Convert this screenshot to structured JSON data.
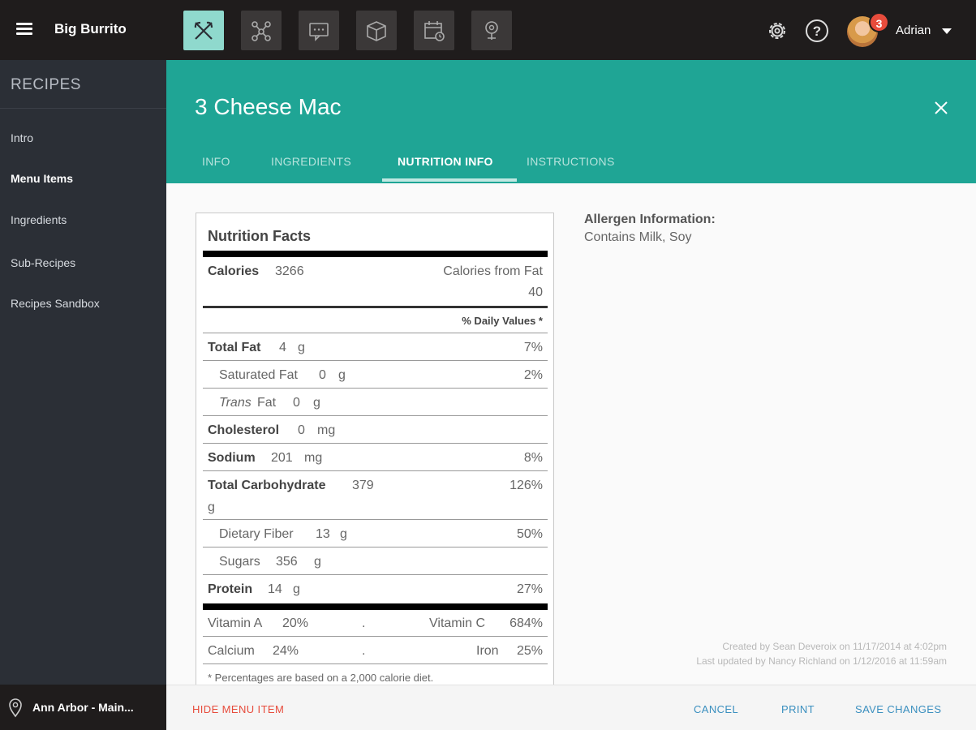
{
  "app": {
    "title": "Big Burrito"
  },
  "user": {
    "name": "Adrian",
    "notifications": "3"
  },
  "sidebar": {
    "heading": "RECIPES",
    "items": [
      {
        "label": "Intro"
      },
      {
        "label": "Menu Items"
      },
      {
        "label": "Ingredients"
      },
      {
        "label": "Sub-Recipes"
      },
      {
        "label": "Recipes Sandbox"
      }
    ],
    "location": "Ann Arbor - Main..."
  },
  "recipe": {
    "title": "3 Cheese Mac",
    "tabs": [
      {
        "label": "INFO"
      },
      {
        "label": "INGREDIENTS"
      },
      {
        "label": "NUTRITION INFO"
      },
      {
        "label": "INSTRUCTIONS"
      }
    ]
  },
  "nutrition": {
    "title": "Nutrition Facts",
    "calories_label": "Calories",
    "calories_value": "3266",
    "calories_fat_label": "Calories from Fat",
    "calories_fat_value": "40",
    "daily_values_label": "% Daily Values *",
    "rows": {
      "total_fat": {
        "label": "Total Fat",
        "amount": "4",
        "unit": "g",
        "dv": "7%"
      },
      "saturated_fat": {
        "label": "Saturated Fat",
        "amount": "0",
        "unit": "g",
        "dv": "2%"
      },
      "trans_fat": {
        "label_italic": "Trans",
        "label_rest": "Fat",
        "amount": "0",
        "unit": "g"
      },
      "cholesterol": {
        "label": "Cholesterol",
        "amount": "0",
        "unit": "mg"
      },
      "sodium": {
        "label": "Sodium",
        "amount": "201",
        "unit": "mg",
        "dv": "8%"
      },
      "total_carbohydrate": {
        "label": "Total Carbohydrate",
        "amount": "379",
        "unit": "g",
        "dv": "126%"
      },
      "dietary_fiber": {
        "label": "Dietary Fiber",
        "amount": "13",
        "unit": "g",
        "dv": "50%"
      },
      "sugars": {
        "label": "Sugars",
        "amount": "356",
        "unit": "g"
      },
      "protein": {
        "label": "Protein",
        "amount": "14",
        "unit": "g",
        "dv": "27%"
      }
    },
    "vitamins": {
      "vitamin_a": {
        "label": "Vitamin A",
        "value": "20%"
      },
      "vitamin_c": {
        "label": "Vitamin C",
        "value": "684%"
      },
      "calcium": {
        "label": "Calcium",
        "value": "24%"
      },
      "iron": {
        "label": "Iron",
        "value": "25%"
      },
      "separator": "."
    },
    "footnote": "* Percentages are based on a 2,000 calorie diet."
  },
  "allergen": {
    "title": "Allergen Information:",
    "text": "Contains Milk, Soy"
  },
  "meta": {
    "created": "Created by Sean Deveroix on 11/17/2014 at 4:02pm",
    "updated": "Last updated by Nancy Richland on 1/12/2016 at 11:59am"
  },
  "footer": {
    "hide": "HIDE MENU ITEM",
    "cancel": "CANCEL",
    "print": "PRINT",
    "save": "SAVE CHANGES"
  },
  "icons": [
    "menu-icon",
    "utensils-icon",
    "network-icon",
    "chat-icon",
    "box-icon",
    "calendar-icon",
    "location-icon",
    "gear-icon",
    "help-icon",
    "caret-down-icon",
    "map-pin-icon",
    "close-icon"
  ],
  "colors": {
    "accent": "#1fa595",
    "danger": "#e74c3c",
    "link": "#3a8fbf"
  }
}
